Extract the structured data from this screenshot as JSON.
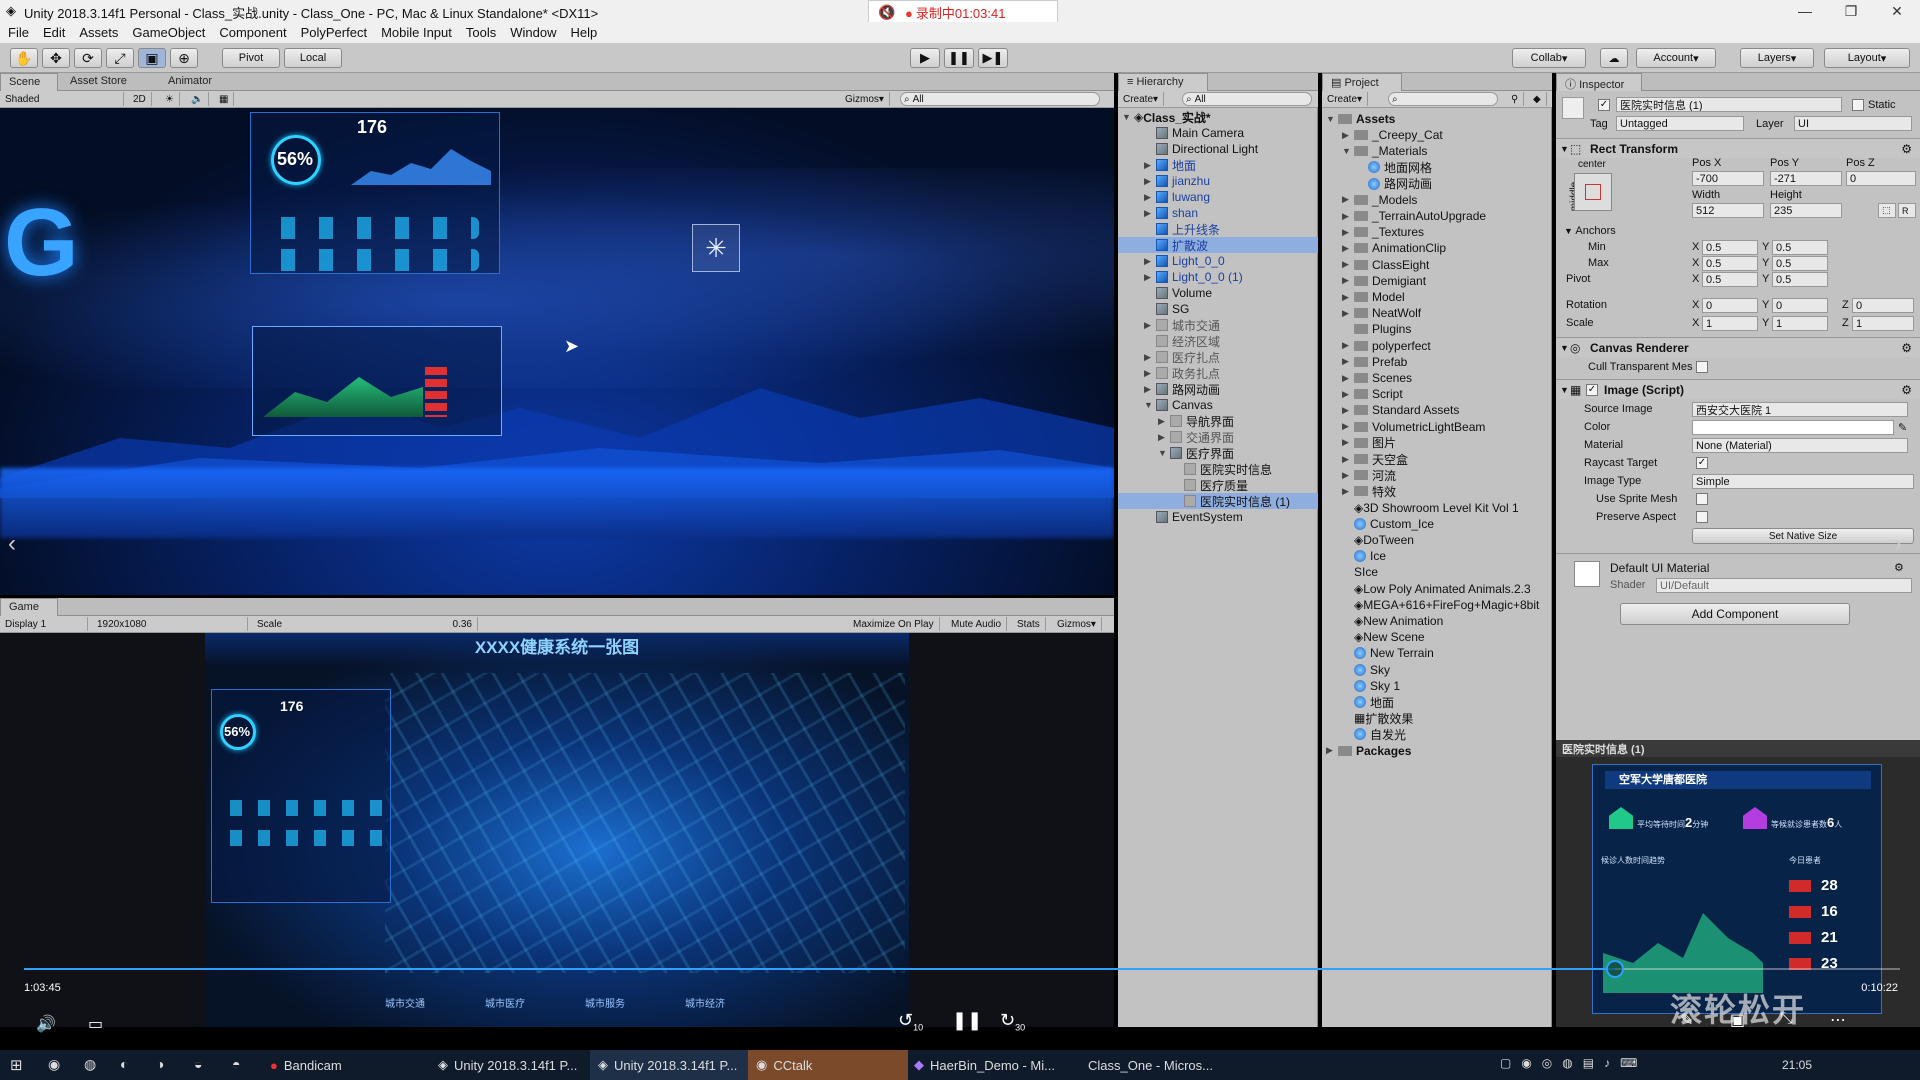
{
  "window": {
    "title": "Unity 2018.3.14f1 Personal - Class_实战.unity - Class_One - PC, Mac & Linux Standalone* <DX11>"
  },
  "recorder": {
    "status": "录制中01:03:41"
  },
  "menu": [
    "File",
    "Edit",
    "Assets",
    "GameObject",
    "Component",
    "PolyPerfect",
    "Mobile Input",
    "Tools",
    "Window",
    "Help"
  ],
  "toolbar": {
    "pivot": "Pivot",
    "local": "Local",
    "collab": "Collab",
    "account": "Account",
    "layers": "Layers",
    "layout": "Layout"
  },
  "scene": {
    "tabs": [
      "Scene",
      "Asset Store",
      "Animator"
    ],
    "shading": "Shaded",
    "mode2d": "2D",
    "gizmos": "Gizmos",
    "search_placeholder": "All",
    "hud_value": "176",
    "hud_percent": "56%"
  },
  "game": {
    "tab": "Game",
    "display": "Display 1",
    "resolution": "1920x1080",
    "scale_label": "Scale",
    "scale_value": "0.36",
    "maximize": "Maximize On Play",
    "mute": "Mute Audio",
    "stats": "Stats",
    "gizmos": "Gizmos",
    "title": "XXXX健康系统一张图",
    "hud_value": "176",
    "hud_percent": "56%",
    "nav": [
      "城市交通",
      "城市医疗",
      "城市服务",
      "城市经济"
    ]
  },
  "hierarchy": {
    "tab": "Hierarchy",
    "create": "Create",
    "search_placeholder": "All",
    "scene_name": "Class_实战*",
    "items": [
      {
        "label": "Main Camera"
      },
      {
        "label": "Directional Light"
      },
      {
        "label": "地面"
      },
      {
        "label": "jianzhu"
      },
      {
        "label": "luwang"
      },
      {
        "label": "shan"
      },
      {
        "label": "上升线条"
      },
      {
        "label": "扩散波"
      },
      {
        "label": "Light_0_0"
      },
      {
        "label": "Light_0_0 (1)"
      },
      {
        "label": "Volume"
      },
      {
        "label": "SG"
      },
      {
        "label": "城市交通"
      },
      {
        "label": "经济区域"
      },
      {
        "label": "医疗扎点"
      },
      {
        "label": "政务扎点"
      },
      {
        "label": "路网动画"
      },
      {
        "label": "Canvas"
      },
      {
        "label": "导航界面"
      },
      {
        "label": "交通界面"
      },
      {
        "label": "医疗界面"
      },
      {
        "label": "医院实时信息"
      },
      {
        "label": "医疗质量"
      },
      {
        "label": "医院实时信息 (1)"
      },
      {
        "label": "EventSystem"
      }
    ]
  },
  "project": {
    "tab": "Project",
    "create": "Create",
    "root": "Assets",
    "items": [
      {
        "label": "_Creepy_Cat"
      },
      {
        "label": "_Materials"
      },
      {
        "label": "地面网格"
      },
      {
        "label": "路网动画"
      },
      {
        "label": "_Models"
      },
      {
        "label": "_TerrainAutoUpgrade"
      },
      {
        "label": "_Textures"
      },
      {
        "label": "AnimationClip"
      },
      {
        "label": "ClassEight"
      },
      {
        "label": "Demigiant"
      },
      {
        "label": "Model"
      },
      {
        "label": "NeatWolf"
      },
      {
        "label": "Plugins"
      },
      {
        "label": "polyperfect"
      },
      {
        "label": "Prefab"
      },
      {
        "label": "Scenes"
      },
      {
        "label": "Script"
      },
      {
        "label": "Standard Assets"
      },
      {
        "label": "VolumetricLightBeam"
      },
      {
        "label": "图片"
      },
      {
        "label": "天空盒"
      },
      {
        "label": "河流"
      },
      {
        "label": "特效"
      },
      {
        "label": "3D Showroom Level Kit Vol 1"
      },
      {
        "label": "Custom_Ice"
      },
      {
        "label": "DoTween"
      },
      {
        "label": "Ice"
      },
      {
        "label": "Ice"
      },
      {
        "label": "Low Poly Animated Animals.2.3"
      },
      {
        "label": "MEGA+616+FireFog+Magic+8bit"
      },
      {
        "label": "New Animation"
      },
      {
        "label": "New Scene"
      },
      {
        "label": "New Terrain"
      },
      {
        "label": "Sky"
      },
      {
        "label": "Sky 1"
      },
      {
        "label": "地面"
      },
      {
        "label": "扩散效果"
      },
      {
        "label": "自发光"
      },
      {
        "label": "Packages"
      }
    ]
  },
  "inspector": {
    "tab": "Inspector",
    "object_name": "医院实时信息 (1)",
    "static": "Static",
    "tag_label": "Tag",
    "tag": "Untagged",
    "layer_label": "Layer",
    "layer": "UI",
    "rect": {
      "title": "Rect Transform",
      "anchor_preset": "center",
      "middle": "middle",
      "posx_label": "Pos X",
      "posy_label": "Pos Y",
      "posz_label": "Pos Z",
      "posx": "-700",
      "posy": "-271",
      "posz": "0",
      "width_label": "Width",
      "height_label": "Height",
      "width": "512",
      "height": "235",
      "anchors": "Anchors",
      "min": "Min",
      "max": "Max",
      "pivot": "Pivot",
      "min_x": "0.5",
      "min_y": "0.5",
      "max_x": "0.5",
      "max_y": "0.5",
      "pivot_x": "0.5",
      "pivot_y": "0.5",
      "rotation": "Rotation",
      "scale": "Scale",
      "rot_x": "0",
      "rot_y": "0",
      "rot_z": "0",
      "scale_x": "1",
      "scale_y": "1",
      "scale_z": "1"
    },
    "canvas_renderer": {
      "title": "Canvas Renderer",
      "cull": "Cull Transparent Mes"
    },
    "image": {
      "title": "Image (Script)",
      "source_label": "Source Image",
      "source": "西安交大医院 1",
      "color_label": "Color",
      "material_label": "Material",
      "material": "None (Material)",
      "raycast": "Raycast Target",
      "type_label": "Image Type",
      "type": "Simple",
      "sprite_mesh": "Use Sprite Mesh",
      "preserve": "Preserve Aspect",
      "native": "Set Native Size"
    },
    "material": {
      "title": "Default UI Material",
      "shader_label": "Shader",
      "shader": "UI/Default"
    },
    "add_component": "Add Component"
  },
  "preview": {
    "title": "医院实时信息 (1)",
    "hospital": "空军大学唐都医院",
    "wait": "平均等待时间",
    "wait_num": "2",
    "wait_unit": "分钟",
    "queue": "等候就诊患者数",
    "queue_num": "6",
    "queue_unit": "人",
    "patients": "候诊人数时间趋势",
    "today": "今日患者",
    "vals": [
      "28",
      "16",
      "21",
      "23"
    ]
  },
  "video": {
    "elapsed": "1:03:45",
    "remaining": "0:10:22",
    "progress": 0.848,
    "back": "10",
    "fwd": "30"
  },
  "watermark": "滚轮松开",
  "taskbar": {
    "items": [
      "Bandicam",
      "Unity 2018.3.14f1 P...",
      "Unity 2018.3.14f1 P...",
      "CCtalk",
      "HaerBin_Demo - Mi...",
      "Class_One - Micros..."
    ],
    "time": "21:05"
  }
}
